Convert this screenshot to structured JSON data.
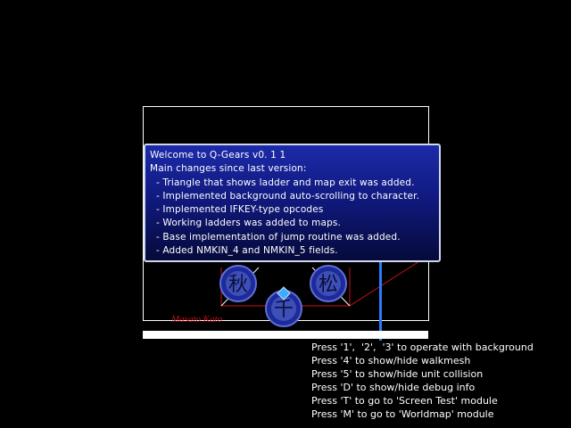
{
  "dialog": {
    "lines": [
      "Welcome to Q-Gears v0. 1 1",
      "Main changes since last version:",
      "  - Triangle that shows ladder and map exit was added.",
      "  - Implemented background auto-scrolling to character.",
      "  - Implemented IFKEY-type opcodes",
      "  - Working ladders was added to maps.",
      "  - Base implementation of jump routine was added.",
      "  - Added NMKIN_4 and NMKIN_5 fields."
    ]
  },
  "credit": "Masato Kato",
  "sprites": [
    {
      "name": "kanji-emblem-left",
      "glyph": "秋"
    },
    {
      "name": "kanji-emblem-right",
      "glyph": "松"
    },
    {
      "name": "kanji-emblem-center",
      "glyph": "千"
    }
  ],
  "help": {
    "lines": [
      "Press '1',  '2',  '3' to operate with background",
      "Press '4' to show/hide walkmesh",
      "Press '5' to show/hide unit collision",
      "Press 'D' to show/hide debug info",
      "Press 'T' to go to 'Screen Test' module",
      "Press 'M' to go to 'Worldmap' module"
    ]
  },
  "colors": {
    "background": "#000000",
    "dialog_blue": "#1c2aa8",
    "walkmesh_red": "#c81414",
    "marker_blue": "#2a7cff",
    "credit_red": "#c21010"
  }
}
